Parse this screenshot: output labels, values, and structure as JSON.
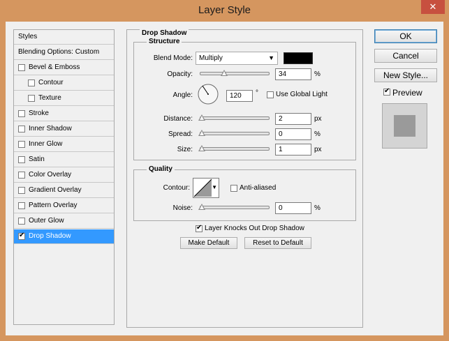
{
  "window": {
    "title": "Layer Style",
    "close_glyph": "✕"
  },
  "sidebar": {
    "items": [
      {
        "label": "Styles",
        "checkbox": false
      },
      {
        "label": "Blending Options: Custom",
        "checkbox": false
      },
      {
        "label": "Bevel & Emboss",
        "checkbox": true,
        "checked": false
      },
      {
        "label": "Contour",
        "checkbox": true,
        "checked": false
      },
      {
        "label": "Texture",
        "checkbox": true,
        "checked": false
      },
      {
        "label": "Stroke",
        "checkbox": true,
        "checked": false
      },
      {
        "label": "Inner Shadow",
        "checkbox": true,
        "checked": false
      },
      {
        "label": "Inner Glow",
        "checkbox": true,
        "checked": false
      },
      {
        "label": "Satin",
        "checkbox": true,
        "checked": false
      },
      {
        "label": "Color Overlay",
        "checkbox": true,
        "checked": false
      },
      {
        "label": "Gradient Overlay",
        "checkbox": true,
        "checked": false
      },
      {
        "label": "Pattern Overlay",
        "checkbox": true,
        "checked": false
      },
      {
        "label": "Outer Glow",
        "checkbox": true,
        "checked": false
      },
      {
        "label": "Drop Shadow",
        "checkbox": true,
        "checked": true
      }
    ]
  },
  "panel": {
    "title": "Drop Shadow",
    "structure": {
      "title": "Structure",
      "blend_mode_label": "Blend Mode:",
      "blend_mode_value": "Multiply",
      "shadow_color": "#000000",
      "opacity_label": "Opacity:",
      "opacity_value": "34",
      "opacity_unit": "%",
      "angle_label": "Angle:",
      "angle_value": "120",
      "angle_unit": "°",
      "global_light_label": "Use Global Light",
      "global_light_checked": false,
      "distance_label": "Distance:",
      "distance_value": "2",
      "distance_unit": "px",
      "spread_label": "Spread:",
      "spread_value": "0",
      "spread_unit": "%",
      "size_label": "Size:",
      "size_value": "1",
      "size_unit": "px"
    },
    "quality": {
      "title": "Quality",
      "contour_label": "Contour:",
      "anti_aliased_label": "Anti-aliased",
      "anti_aliased_checked": false,
      "noise_label": "Noise:",
      "noise_value": "0",
      "noise_unit": "%"
    },
    "knockout_label": "Layer Knocks Out Drop Shadow",
    "knockout_checked": true,
    "make_default_label": "Make Default",
    "reset_default_label": "Reset to Default"
  },
  "buttons": {
    "ok": "OK",
    "cancel": "Cancel",
    "new_style": "New Style...",
    "preview_label": "Preview",
    "preview_checked": true
  },
  "colors": {
    "title_bar": "#d5965f",
    "close_button": "#c7503f",
    "selection": "#3399ff"
  }
}
